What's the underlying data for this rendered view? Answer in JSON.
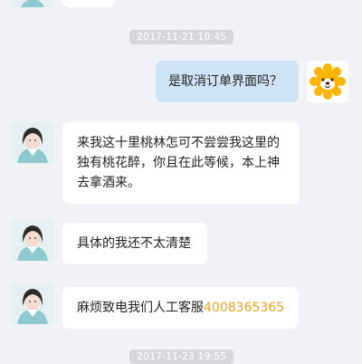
{
  "chat": {
    "timestamp_1": "2017-11-21 10:45",
    "timestamp_2": "2017-11-23 19:55",
    "user_message": "是取消订单界面吗？",
    "agent_msg_1": "来我这十里桃林怎可不尝尝我这里的独有桃花醉，你且在此等候，本上神去拿酒来。",
    "agent_msg_1_lines": [
      "来我这十里桃林怎可不尝尝我这里的",
      "独有桃花醉，你且在此等候，本上神",
      "去拿酒来。"
    ],
    "agent_msg_2": "具体的我还不太清楚",
    "agent_msg_3_text": "麻烦致电我们人工客服",
    "agent_msg_3_phone": "4008365365"
  },
  "icons": {
    "agent_avatar": "female-character-avatar",
    "user_avatar": "sun-mascot-avatar"
  },
  "colors": {
    "background": "#f1f2f6",
    "user_bubble": "#cfe3f6",
    "agent_bubble": "#ffffff",
    "phone_link": "#f1a21a",
    "mascot_yellow": "#ffb400",
    "timestamp_bg": "#d5d7dc"
  }
}
